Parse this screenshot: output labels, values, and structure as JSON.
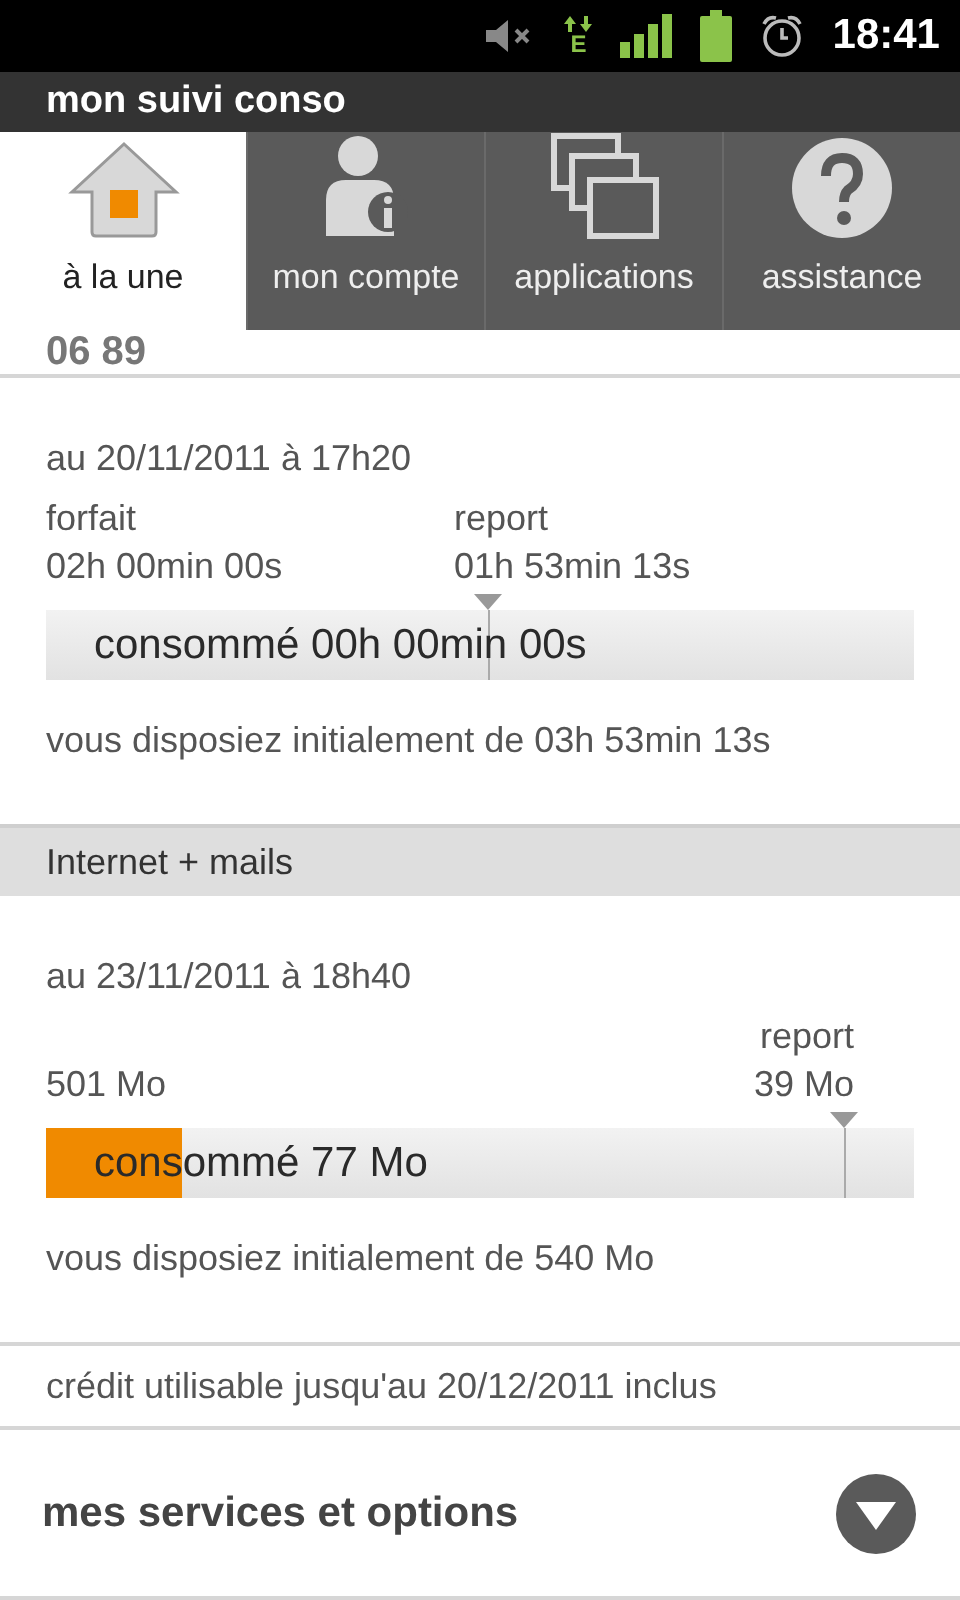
{
  "status_bar": {
    "time": "18:41",
    "network_letter": "E"
  },
  "app_title": "mon suivi conso",
  "tabs": [
    {
      "label": "à la une",
      "selected": true
    },
    {
      "label": "mon compte",
      "selected": false
    },
    {
      "label": "applications",
      "selected": false
    },
    {
      "label": "assistance",
      "selected": false
    }
  ],
  "cut_off_text": "06 89",
  "sections": [
    {
      "kind": "split",
      "date": "au 20/11/2011 à 17h20",
      "left_label": "forfait",
      "left_value": "02h 00min 00s",
      "right_label": "report",
      "right_value": "01h 53min 13s",
      "bar_label": "consommé 00h 00min 00s",
      "initial": "vous disposiez initialement de 03h 53min 13s"
    },
    {
      "header": "Internet + mails",
      "kind": "right",
      "date": "au 23/11/2011 à 18h40",
      "left_value": "501 Mo",
      "right_label": "report",
      "right_value": "39 Mo",
      "bar_label": "consommé 77 Mo",
      "level": 0.157,
      "initial": "vous disposiez initialement de 540 Mo"
    }
  ],
  "credit": "crédit utilisable jusqu'au 20/12/2011 inclus",
  "services": {
    "label": "mes services et options",
    "expanded": false
  }
}
